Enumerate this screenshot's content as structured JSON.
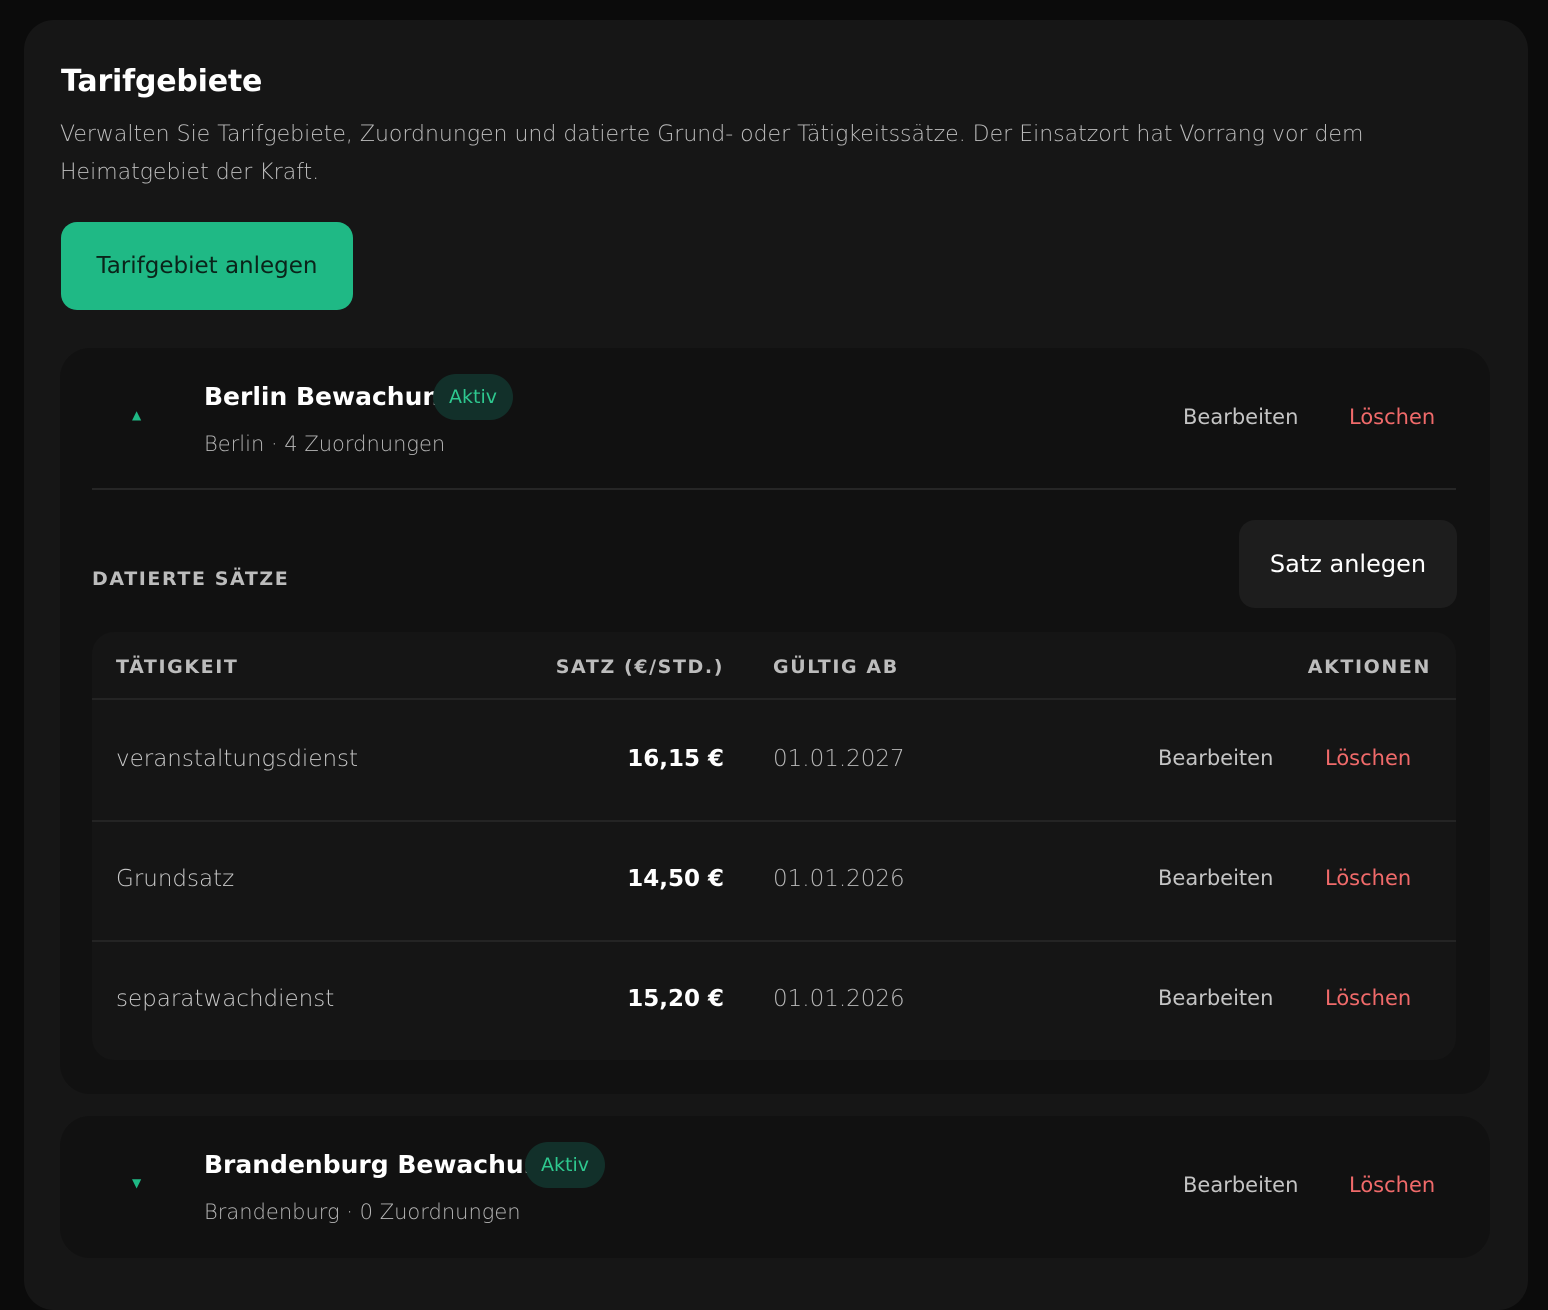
{
  "page": {
    "title": "Tarifgebiete",
    "description": "Verwalten Sie Tarifgebiete, Zuordnungen und datierte Grund- oder Tätigkeitssätze. Der Einsatzort hat Vorrang vor dem Heimatgebiet der Kraft.",
    "create_button": "Tarifgebiet anlegen"
  },
  "areas": [
    {
      "name": "Berlin Bewachung",
      "status": "Aktiv",
      "subtitle": "Berlin · 4 Zuordnungen",
      "edit_label": "Bearbeiten",
      "delete_label": "Löschen",
      "expanded": true,
      "chevron": "▲",
      "rates_section": {
        "label": "DATIERTE SÄTZE",
        "add_button": "Satz anlegen",
        "columns": [
          "TÄTIGKEIT",
          "SATZ (€/STD.)",
          "GÜLTIG AB",
          "AKTIONEN"
        ],
        "rows": [
          {
            "activity": "veranstaltungsdienst",
            "rate": "16,15 €",
            "valid_from": "01.01.2027",
            "edit": "Bearbeiten",
            "delete": "Löschen"
          },
          {
            "activity": "Grundsatz",
            "rate": "14,50 €",
            "valid_from": "01.01.2026",
            "edit": "Bearbeiten",
            "delete": "Löschen"
          },
          {
            "activity": "separatwachdienst",
            "rate": "15,20 €",
            "valid_from": "01.01.2026",
            "edit": "Bearbeiten",
            "delete": "Löschen"
          }
        ]
      }
    },
    {
      "name": "Brandenburg Bewachung",
      "status": "Aktiv",
      "subtitle": "Brandenburg · 0 Zuordnungen",
      "edit_label": "Bearbeiten",
      "delete_label": "Löschen",
      "expanded": false,
      "chevron": "▼"
    }
  ],
  "colors": {
    "accent": "#1fb985",
    "danger": "#f06a6a",
    "badge_bg": "#12302a",
    "badge_text": "#2ec88f"
  }
}
